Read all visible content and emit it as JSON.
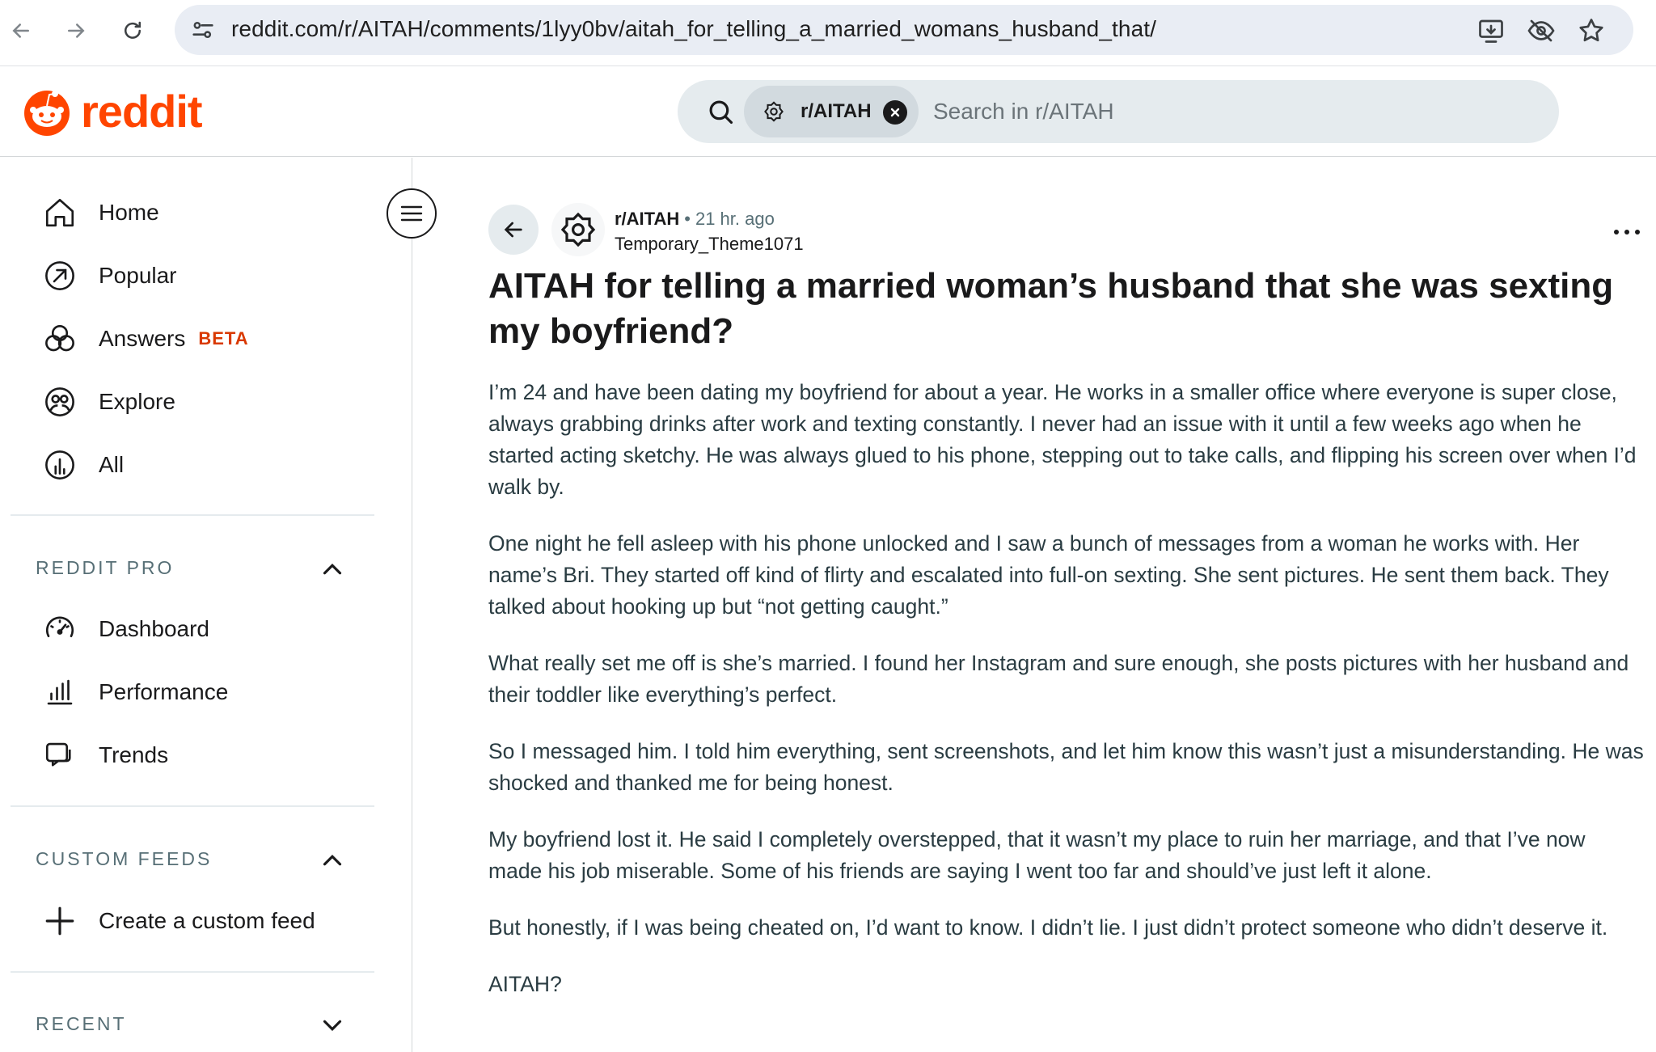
{
  "browser": {
    "url": "reddit.com/r/AITAH/comments/1lyy0bv/aitah_for_telling_a_married_womans_husband_that/"
  },
  "header": {
    "logo_text": "reddit",
    "search": {
      "chip_label": "r/AITAH",
      "placeholder": "Search in r/AITAH"
    }
  },
  "sidebar": {
    "items": [
      {
        "label": "Home",
        "icon": "home-icon"
      },
      {
        "label": "Popular",
        "icon": "popular-icon"
      },
      {
        "label": "Answers",
        "icon": "answers-icon",
        "badge": "BETA"
      },
      {
        "label": "Explore",
        "icon": "explore-icon"
      },
      {
        "label": "All",
        "icon": "all-icon"
      }
    ],
    "reddit_pro": {
      "heading": "REDDIT PRO",
      "items": [
        {
          "label": "Dashboard",
          "icon": "dashboard-icon"
        },
        {
          "label": "Performance",
          "icon": "performance-icon"
        },
        {
          "label": "Trends",
          "icon": "trends-icon"
        }
      ]
    },
    "custom_feeds": {
      "heading": "CUSTOM FEEDS",
      "items": [
        {
          "label": "Create a custom feed",
          "icon": "plus-icon"
        }
      ]
    },
    "recent": {
      "heading": "RECENT"
    }
  },
  "post": {
    "subreddit": "r/AITAH",
    "separator": "•",
    "time_ago": "21 hr. ago",
    "author": "Temporary_Theme1071",
    "title": "AITAH for telling a married woman’s husband that she was sexting my boyfriend?",
    "paragraphs": [
      "I’m 24 and have been dating my boyfriend for about a year. He works in a smaller office where everyone is super close, always grabbing drinks after work and texting constantly. I never had an issue with it until a few weeks ago when he started acting sketchy. He was always glued to his phone, stepping out to take calls, and flipping his screen over when I’d walk by.",
      "One night he fell asleep with his phone unlocked and I saw a bunch of messages from a woman he works with. Her name’s Bri. They started off kind of flirty and escalated into full-on sexting. She sent pictures. He sent them back. They talked about hooking up but “not getting caught.”",
      "What really set me off is she’s married. I found her Instagram and sure enough, she posts pictures with her husband and their toddler like everything’s perfect.",
      "So I messaged him. I told him everything, sent screenshots, and let him know this wasn’t just a misunderstanding. He was shocked and thanked me for being honest.",
      "My boyfriend lost it. He said I completely overstepped, that it wasn’t my place to ruin her marriage, and that I’ve now made his job miserable. Some of his friends are saying I went too far and should’ve just left it alone.",
      "But honestly, if I was being cheated on, I’d want to know. I didn’t lie. I just didn’t protect someone who didn’t deserve it.",
      "AITAH?"
    ]
  },
  "colors": {
    "brand": "#ff4500",
    "beta": "#d93900",
    "search_bg": "#e5ebee"
  }
}
